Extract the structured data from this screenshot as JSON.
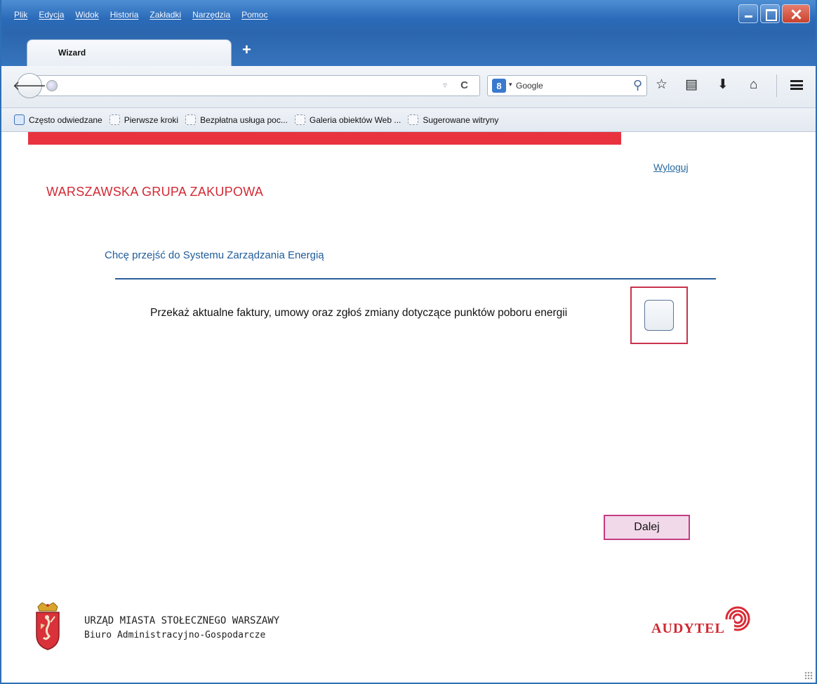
{
  "browser": {
    "menu": [
      "Plik",
      "Edycja",
      "Widok",
      "Historia",
      "Zakładki",
      "Narzędzia",
      "Pomoc"
    ],
    "tab_title": "Wizard",
    "new_tab_symbol": "+",
    "url": "",
    "search_engine": "Google",
    "search_engine_badge": "8",
    "bookmarks": [
      "Często odwiedzane",
      "Pierwsze kroki",
      "Bezpłatna usługa poc...",
      "Galeria obiektów Web ...",
      "Sugerowane witryny"
    ]
  },
  "page": {
    "logout_label": "Wyloguj",
    "brand_title": "WARSZAWSKA GRUPA ZAKUPOWA",
    "section_heading": "Chcę przejść do Systemu Zarządzania Energią",
    "task_text": "Przekaż aktualne faktury, umowy oraz zgłoś zmiany dotyczące punktów poboru energii",
    "task_checked": false,
    "next_label": "Dalej"
  },
  "footer": {
    "city_name": "URZĄD MIASTA STOŁECZNEGO WARSZAWY",
    "office_name": "Biuro Administracyjno-Gospodarcze",
    "partner_logo": "AUDYTEL"
  },
  "colors": {
    "brand_red": "#d22a35",
    "accent_blue": "#1f5b99",
    "button_fill": "#f1d9ea",
    "button_border": "#c33d82"
  }
}
